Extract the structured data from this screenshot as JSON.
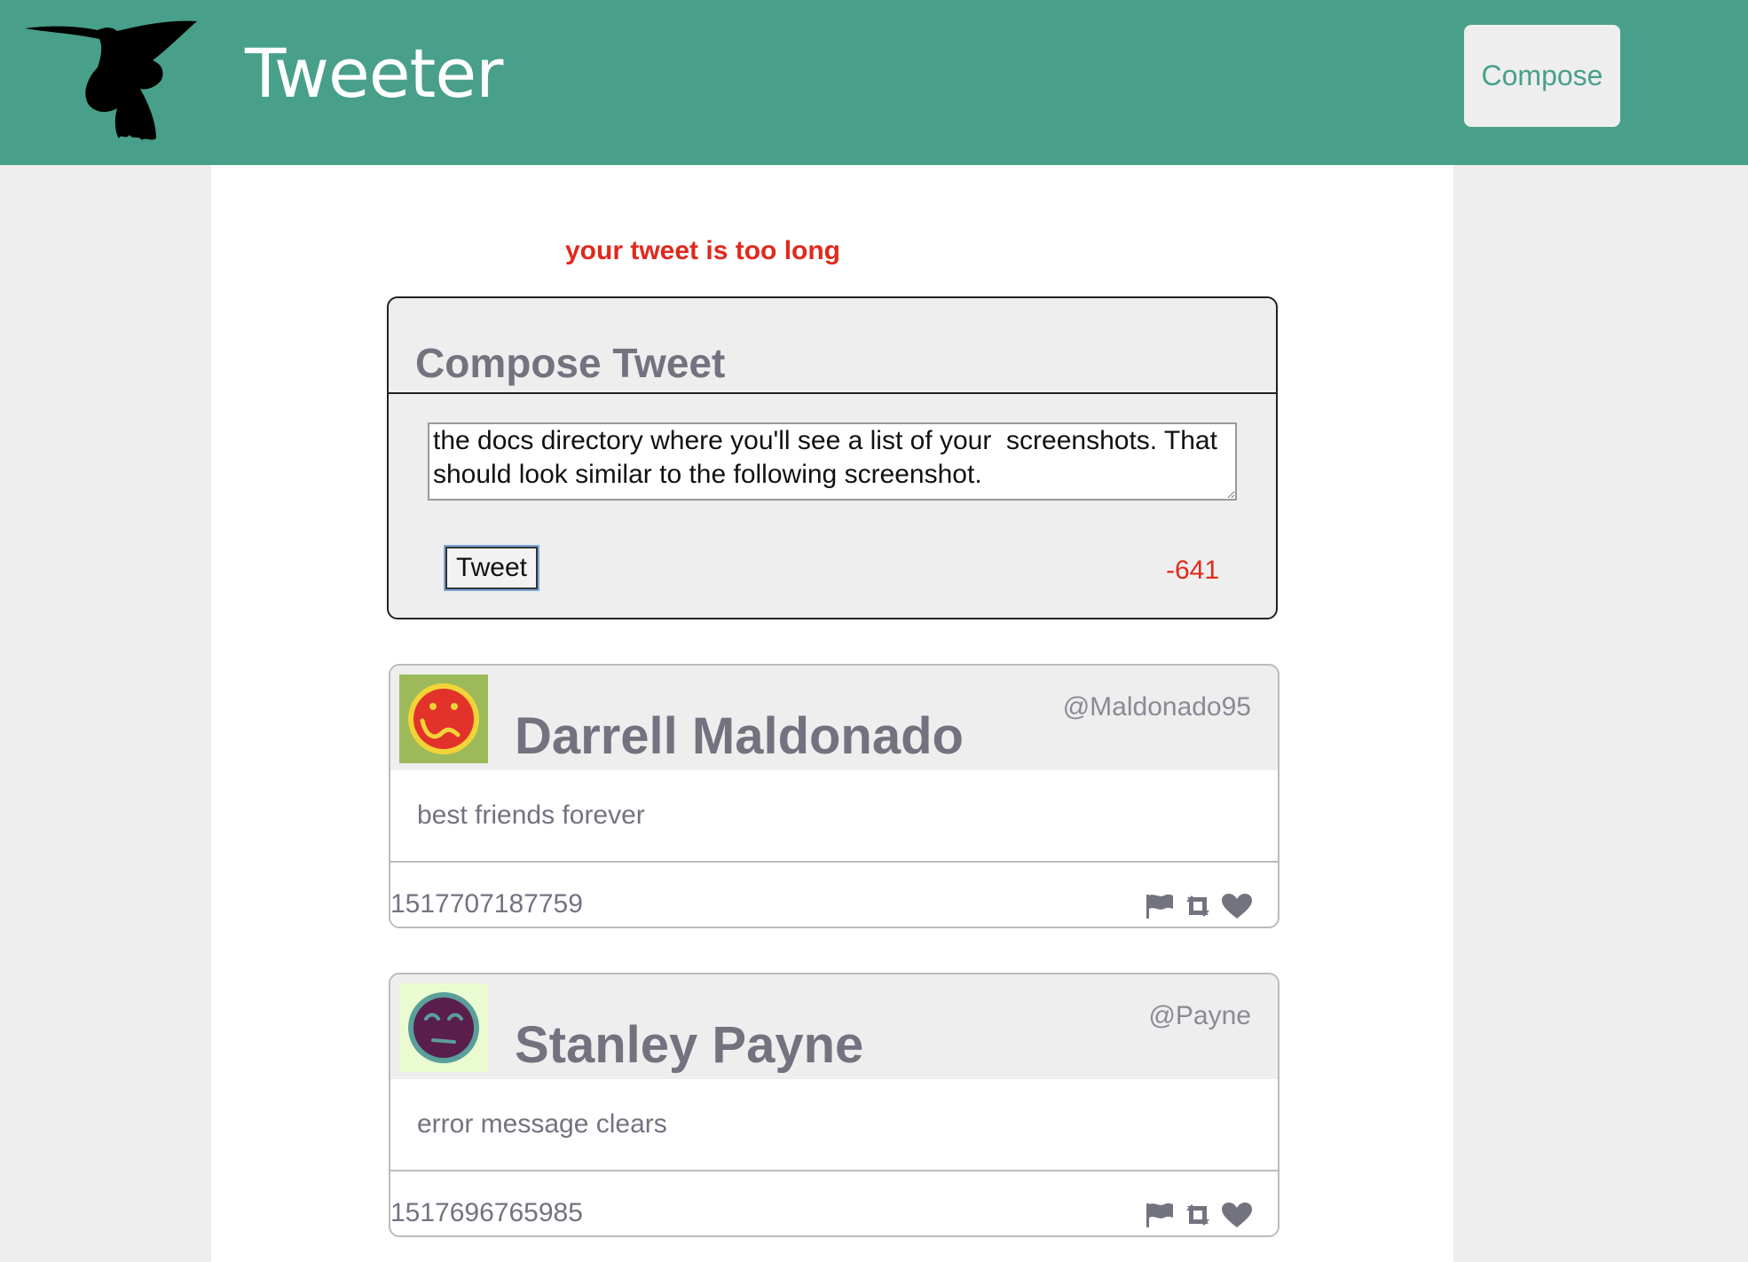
{
  "nav": {
    "brand": "Tweeter",
    "compose_label": "Compose",
    "logo_icon": "hummingbird-icon",
    "colors": {
      "background": "#48a08a",
      "text": "#ffffff"
    }
  },
  "error": {
    "message": "your tweet is too long",
    "color": "#e0291c"
  },
  "compose": {
    "title": "Compose Tweet",
    "textarea_value": "the docs directory where you'll see a list of your  screenshots. That should look similar to the following screenshot.",
    "submit_label": "Tweet",
    "counter": "-641"
  },
  "tweets": [
    {
      "name": "Darrell Maldonado",
      "handle": "@Maldonado95",
      "content": "best friends forever",
      "timestamp": "1517707187759",
      "avatar_icon": "smiley-avatar-icon"
    },
    {
      "name": "Stanley Payne",
      "handle": "@Payne",
      "content": "error message clears",
      "timestamp": "1517696765985",
      "avatar_icon": "smiley-avatar-icon"
    }
  ],
  "actions": {
    "icons": [
      "flag-icon",
      "retweet-icon",
      "heart-icon"
    ],
    "color": "#737380"
  }
}
